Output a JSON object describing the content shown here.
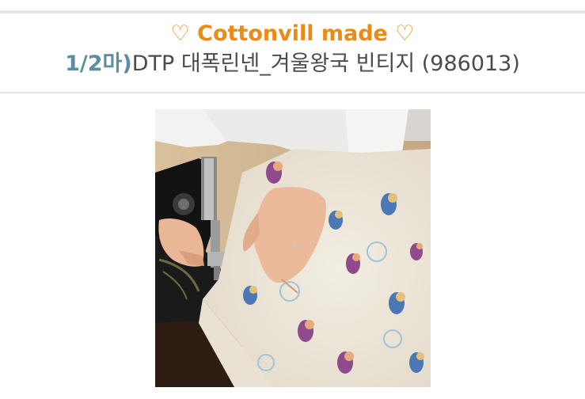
{
  "header": {
    "heart_left": "♡",
    "brand": "Cottonvill made",
    "heart_right": "♡"
  },
  "product": {
    "quantity": "1/2마)",
    "name": "DTP 대폭린넨_겨울왕국 빈티지 (986013)"
  },
  "colors": {
    "brand": "#ec8a14",
    "quantity": "#5b8fa0",
    "title_text": "#4b4b4b"
  }
}
